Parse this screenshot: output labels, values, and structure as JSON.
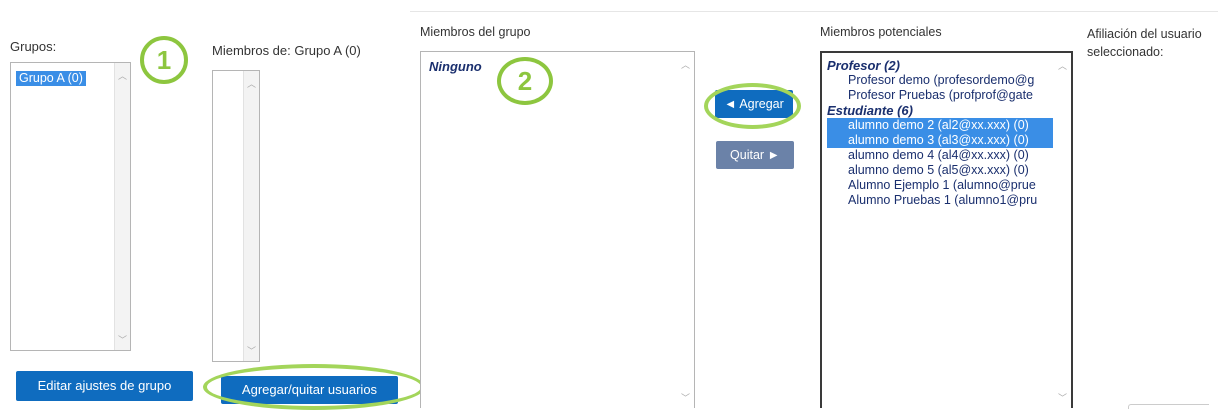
{
  "groups": {
    "label": "Grupos:",
    "items": [
      "Grupo A (0)"
    ],
    "edit_button": "Editar ajustes de grupo"
  },
  "members_of": {
    "label": "Miembros de: Grupo A (0)",
    "add_remove_button": "Agregar/quitar usuarios"
  },
  "group_members": {
    "label": "Miembros del grupo",
    "empty_text": "Ninguno"
  },
  "actions": {
    "add_label": "◄ Agregar",
    "remove_label": "Quitar ►"
  },
  "potential_members": {
    "label": "Miembros potenciales",
    "groups": [
      {
        "title": "Profesor (2)",
        "items": [
          {
            "text": "Profesor demo (profesordemo@g",
            "selected": false
          },
          {
            "text": "Profesor Pruebas (profprof@gate",
            "selected": false
          }
        ]
      },
      {
        "title": "Estudiante (6)",
        "items": [
          {
            "text": "alumno demo 2 (al2@xx.xxx) (0)",
            "selected": true
          },
          {
            "text": "alumno demo 3 (al3@xx.xxx) (0)",
            "selected": true
          },
          {
            "text": "alumno demo 4 (al4@xx.xxx) (0)",
            "selected": false
          },
          {
            "text": "alumno demo 5 (al5@xx.xxx) (0)",
            "selected": false
          },
          {
            "text": "Alumno Ejemplo 1 (alumno@prue",
            "selected": false
          },
          {
            "text": "Alumno Pruebas 1 (alumno1@pru",
            "selected": false
          }
        ]
      }
    ]
  },
  "affiliation": {
    "label_line1": "Afiliación del usuario",
    "label_line2": "seleccionado:"
  },
  "callouts": {
    "one": "1",
    "two": "2"
  },
  "colors": {
    "button_blue": "#0f6cbf",
    "selection_blue": "#3a8ee6",
    "highlight_green": "#8dc63f"
  }
}
